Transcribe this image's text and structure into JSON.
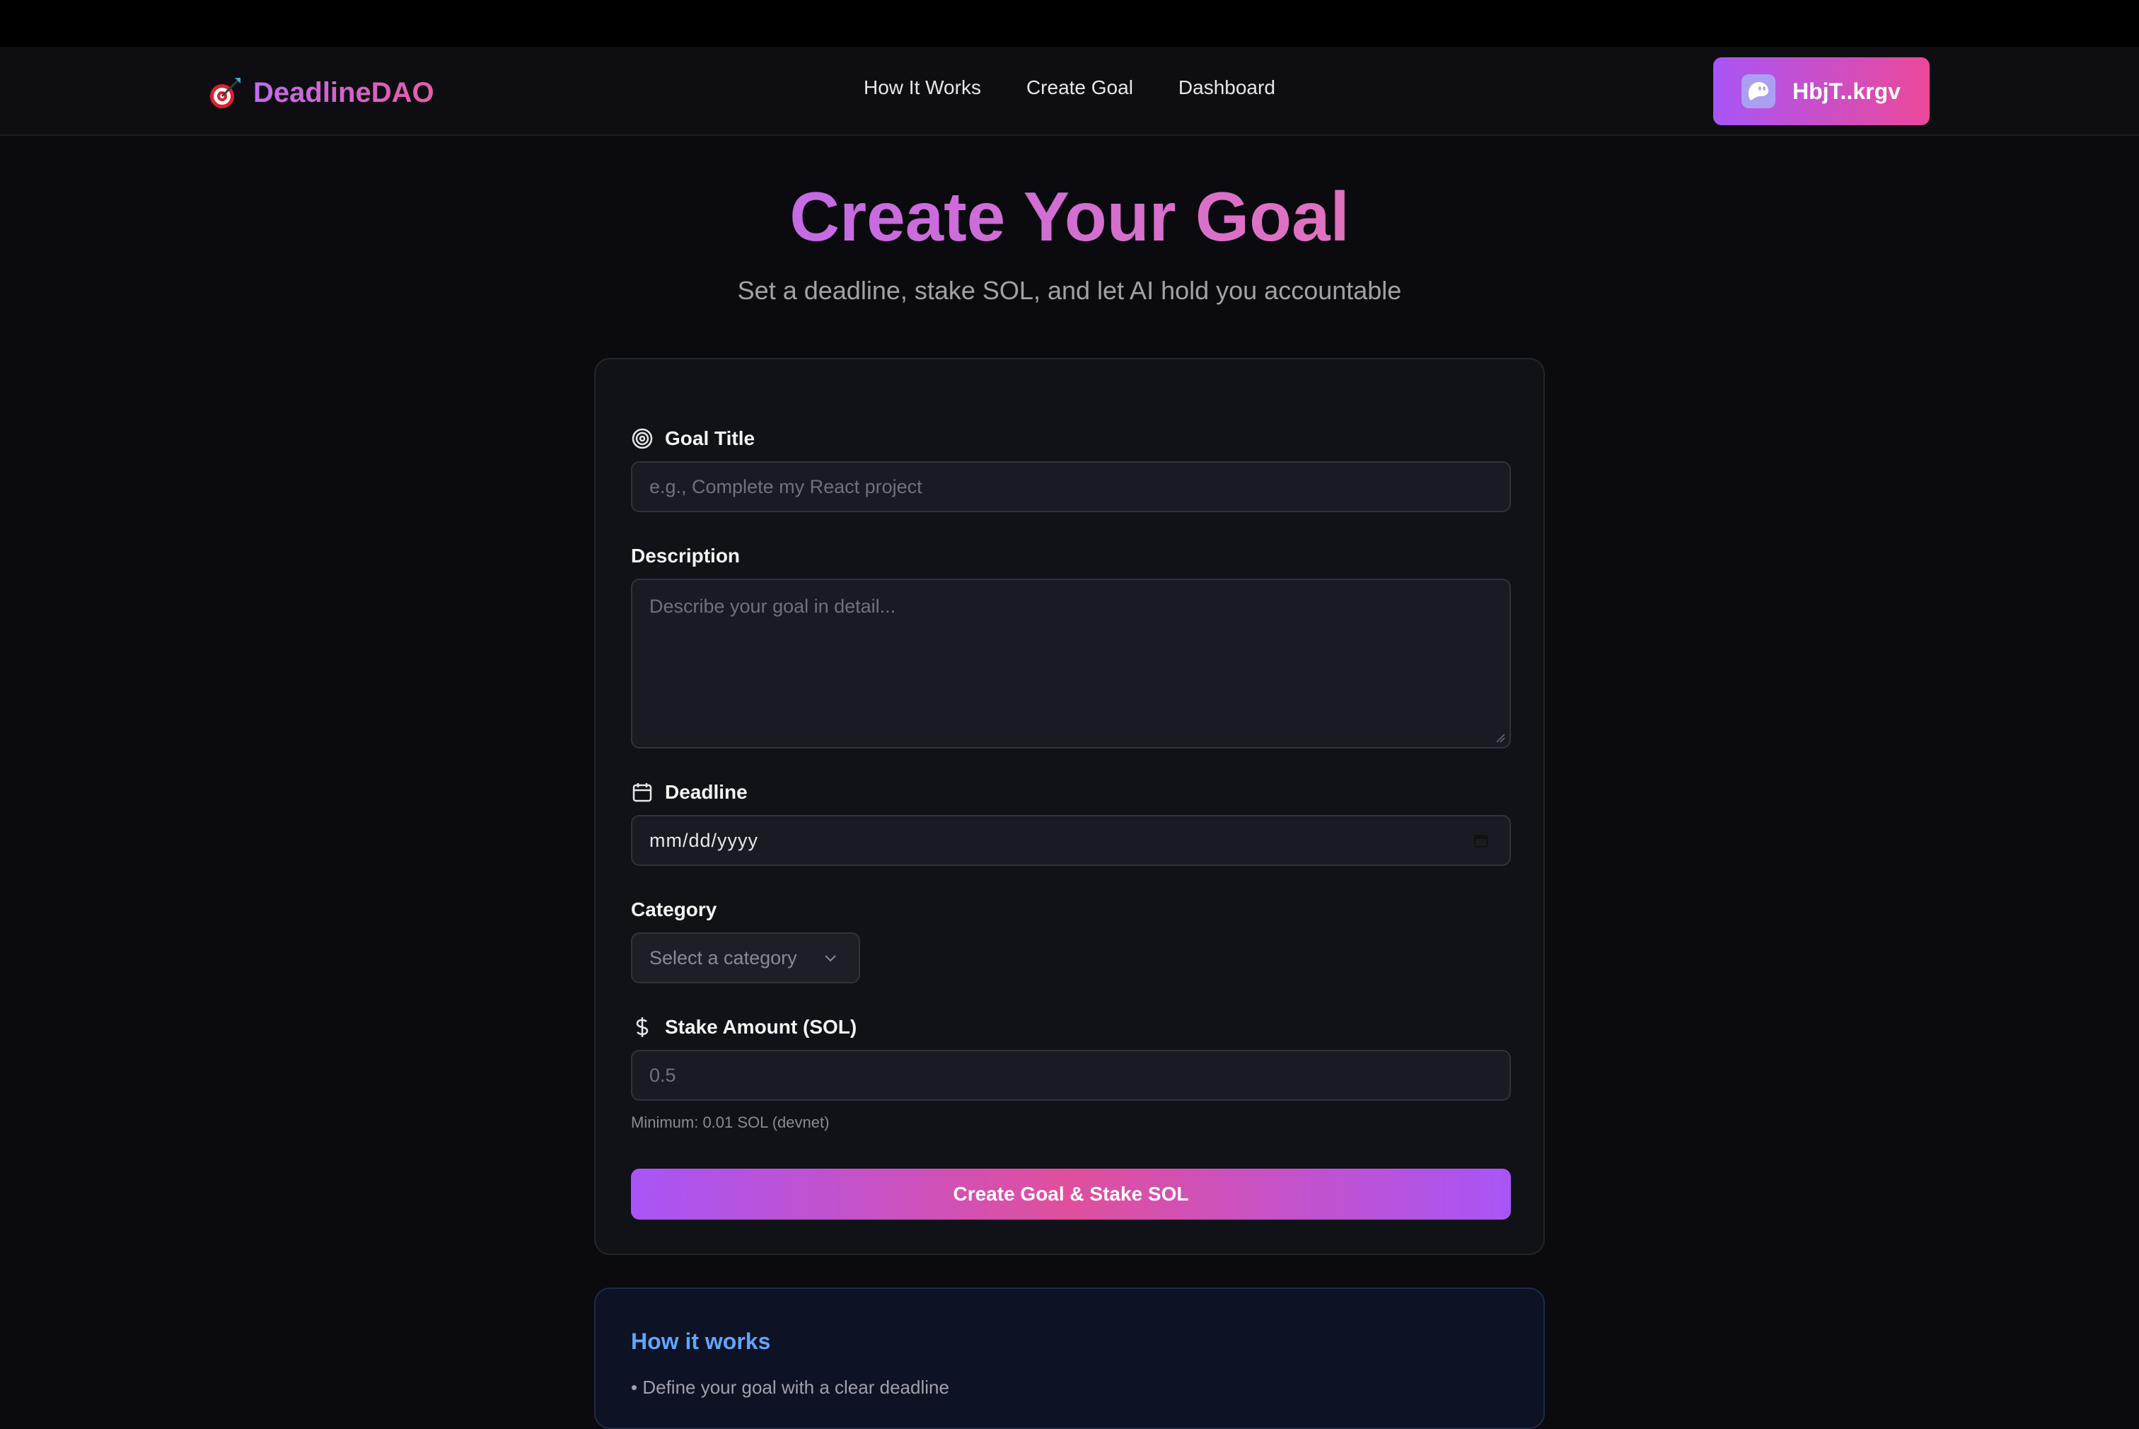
{
  "brand": {
    "name": "DeadlineDAO",
    "icon": "dart-target-icon"
  },
  "nav": {
    "links": [
      "How It Works",
      "Create Goal",
      "Dashboard"
    ]
  },
  "wallet": {
    "label": "HbjT..krgv",
    "icon": "phantom-ghost-icon"
  },
  "hero": {
    "title": "Create Your Goal",
    "subtitle": "Set a deadline, stake SOL, and let AI hold you accountable"
  },
  "form": {
    "goal_title": {
      "label": "Goal Title",
      "placeholder": "e.g., Complete my React project",
      "icon": "target-icon"
    },
    "description": {
      "label": "Description",
      "placeholder": "Describe your goal in detail..."
    },
    "deadline": {
      "label": "Deadline",
      "value": "mm/dd/yyyy",
      "icon": "calendar-icon"
    },
    "category": {
      "label": "Category",
      "placeholder": "Select a category"
    },
    "stake": {
      "label": "Stake Amount (SOL)",
      "placeholder": "0.5",
      "hint": "Minimum: 0.01 SOL (devnet)",
      "icon": "dollar-icon"
    },
    "submit_label": "Create Goal & Stake SOL"
  },
  "how_it_works": {
    "title": "How it works",
    "items": [
      "• Define your goal with a clear deadline"
    ]
  },
  "colors": {
    "accent_purple": "#a855f7",
    "accent_pink": "#ec4899",
    "info_blue": "#60a5fa",
    "background": "#0b0b0f"
  }
}
